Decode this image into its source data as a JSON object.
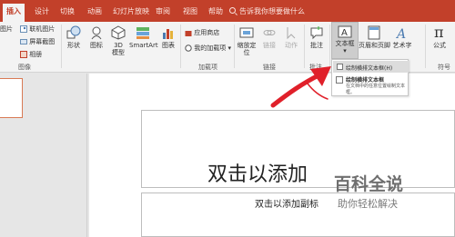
{
  "tabs": [
    {
      "label": "插入",
      "active": true
    },
    {
      "label": "设计"
    },
    {
      "label": "切换"
    },
    {
      "label": "动画"
    },
    {
      "label": "幻灯片放映"
    },
    {
      "label": "审阅"
    },
    {
      "label": "视图"
    },
    {
      "label": "帮助"
    }
  ],
  "tell_me": "告诉我你想要做什么",
  "ribbon": {
    "images_group": {
      "label": "图像",
      "picture": "图片",
      "online_pictures": "联机图片",
      "screenshot": "屏幕截图",
      "album": "相册"
    },
    "illustrations": {
      "shapes": "形状",
      "icons": "图标",
      "model3d_line1": "3D",
      "model3d_line2": "模型",
      "smartart": "SmartArt",
      "chart": "图表"
    },
    "addins_group": {
      "label": "加载项",
      "store": "应用商店",
      "my_addins": "我的加载项"
    },
    "links_group": {
      "label": "链接",
      "zoom_line1": "缩放定",
      "zoom_line2": "位",
      "link": "链接",
      "action": "动作"
    },
    "comments_group": {
      "label": "批注",
      "comment": "批注"
    },
    "text_group": {
      "textbox": "文本框",
      "header_footer": "页眉和页脚",
      "wordart": "艺术字"
    },
    "symbols_group": {
      "label": "符号",
      "equation": "公式"
    }
  },
  "dropdown": {
    "item_label": "绘制横排文本框(H)",
    "title": "绘制横排文本框",
    "description": "在文档中的任意位置绘制文本框。"
  },
  "slide": {
    "title_text": "双击以添加",
    "subtitle_text": "双击以添加副标"
  },
  "watermark": {
    "main": "百科全说",
    "sub": "助你轻松解决"
  },
  "colors": {
    "accent": "#c2402a",
    "arrow": "#e0202a"
  }
}
